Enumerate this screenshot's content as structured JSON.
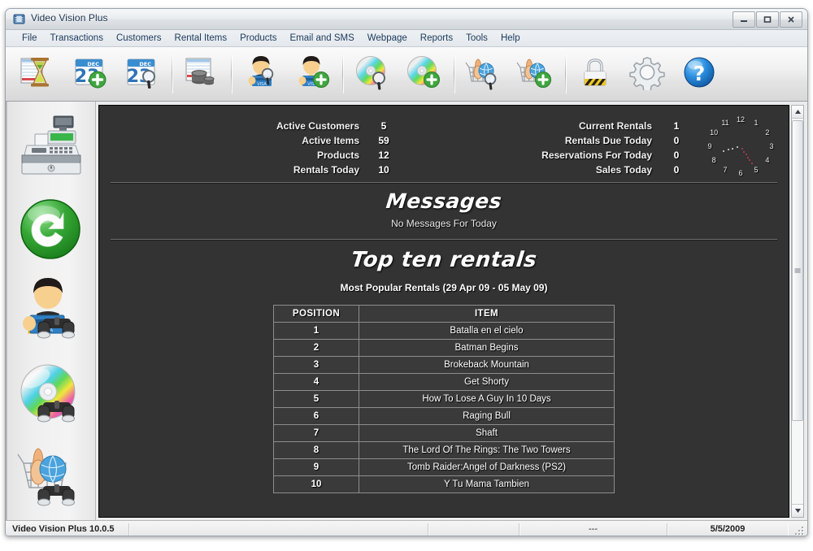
{
  "window": {
    "title": "Video Vision Plus",
    "icon": "app-film-icon",
    "controls": {
      "minimize": "Minimize",
      "restore": "Restore",
      "close": "Close"
    }
  },
  "menubar": {
    "items": [
      {
        "label": "File",
        "name": "menu-file"
      },
      {
        "label": "Transactions",
        "name": "menu-transactions"
      },
      {
        "label": "Customers",
        "name": "menu-customers"
      },
      {
        "label": "Rental Items",
        "name": "menu-rental-items"
      },
      {
        "label": "Products",
        "name": "menu-products"
      },
      {
        "label": "Email and SMS",
        "name": "menu-email-and-sms"
      },
      {
        "label": "Webpage",
        "name": "menu-webpage"
      },
      {
        "label": "Reports",
        "name": "menu-reports"
      },
      {
        "label": "Tools",
        "name": "menu-tools"
      },
      {
        "label": "Help",
        "name": "menu-help"
      }
    ]
  },
  "toolbar": {
    "buttons": [
      {
        "icon": "rent-out-hourglass-icon",
        "tooltip": "Rent Out"
      },
      {
        "icon": "calendar-add-icon",
        "tooltip": "New Reservation"
      },
      {
        "icon": "calendar-search-icon",
        "tooltip": "Find Reservation"
      },
      {
        "icon": "sales-coins-icon",
        "tooltip": "Sales"
      },
      {
        "icon": "customer-search-icon",
        "tooltip": "Find Customer"
      },
      {
        "icon": "customer-add-icon",
        "tooltip": "Add Customer"
      },
      {
        "icon": "disc-search-icon",
        "tooltip": "Find Rental Item"
      },
      {
        "icon": "disc-add-icon",
        "tooltip": "Add Rental Item"
      },
      {
        "icon": "product-search-icon",
        "tooltip": "Find Product"
      },
      {
        "icon": "product-add-icon",
        "tooltip": "Add Product"
      },
      {
        "icon": "lock-icon",
        "tooltip": "Lock"
      },
      {
        "icon": "gear-icon",
        "tooltip": "Settings"
      },
      {
        "icon": "help-question-icon",
        "tooltip": "Help"
      }
    ]
  },
  "sidebar": {
    "items": [
      {
        "icon": "cash-register-icon",
        "label": "Point Of Sale"
      },
      {
        "icon": "return-arrow-icon",
        "label": "Returns"
      },
      {
        "icon": "customer-binoculars-icon",
        "label": "Find Customer"
      },
      {
        "icon": "disc-binoculars-icon",
        "label": "Find Rental Item"
      },
      {
        "icon": "product-binoculars-icon",
        "label": "Find Product"
      }
    ]
  },
  "dashboard": {
    "stats_left": [
      {
        "label": "Active Customers",
        "value": "5"
      },
      {
        "label": "Active Items",
        "value": "59"
      },
      {
        "label": "Products",
        "value": "12"
      },
      {
        "label": "Rentals Today",
        "value": "10"
      }
    ],
    "stats_right": [
      {
        "label": "Current Rentals",
        "value": "1"
      },
      {
        "label": "Rentals Due Today",
        "value": "0"
      },
      {
        "label": "Reservations For Today",
        "value": "0"
      },
      {
        "label": "Sales Today",
        "value": "0"
      }
    ],
    "clock": {
      "name": "analog-clock",
      "numbers": [
        "1",
        "2",
        "3",
        "4",
        "5",
        "6",
        "7",
        "8",
        "9",
        "10",
        "11",
        "12"
      ],
      "hour_hand_color": "#e0e0e0",
      "minute_hand_color": "#c43a52"
    },
    "messages": {
      "heading": "Messages",
      "body": "No Messages For Today"
    },
    "top_rentals": {
      "heading": "Top ten rentals",
      "subheading": "Most Popular Rentals (29 Apr 09 - 05 May 09)",
      "columns": [
        "POSITION",
        "ITEM"
      ],
      "rows": [
        {
          "position": "1",
          "item": "Batalla en el cielo"
        },
        {
          "position": "2",
          "item": "Batman Begins"
        },
        {
          "position": "3",
          "item": "Brokeback Mountain"
        },
        {
          "position": "4",
          "item": "Get Shorty"
        },
        {
          "position": "5",
          "item": "How To Lose A Guy In 10 Days"
        },
        {
          "position": "6",
          "item": "Raging Bull"
        },
        {
          "position": "7",
          "item": "Shaft"
        },
        {
          "position": "8",
          "item": "The Lord Of The Rings: The Two Towers"
        },
        {
          "position": "9",
          "item": "Tomb Raider:Angel of Darkness (PS2)"
        },
        {
          "position": "10",
          "item": "Y Tu Mama Tambien"
        }
      ]
    }
  },
  "statusbar": {
    "version": "Video Vision Plus 10.0.5",
    "cell2": "",
    "cell3": "",
    "cell4": "---",
    "date": "5/5/2009"
  },
  "colors": {
    "panel_bg": "#333333",
    "chrome_bg": "#e8e8e8",
    "title_text": "#19334d",
    "accent_green": "#3fa63f",
    "accent_blue": "#1d7fd0"
  }
}
